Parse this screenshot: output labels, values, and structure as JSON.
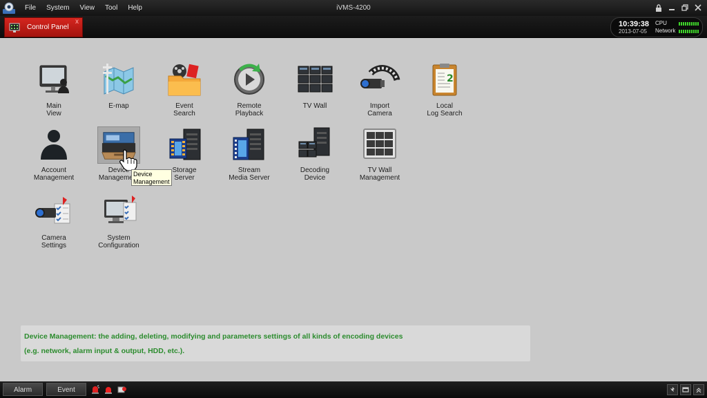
{
  "app": {
    "title": "iVMS-4200",
    "menu": [
      "File",
      "System",
      "View",
      "Tool",
      "Help"
    ]
  },
  "tab": {
    "label": "Control Panel",
    "close": "x"
  },
  "status": {
    "time": "10:39:38",
    "date": "2013-07-05",
    "cpu_label": "CPU",
    "network_label": "Network"
  },
  "modules": [
    {
      "name": "main-view",
      "line1": "Main",
      "line2": "View",
      "icon": "monitor-user-icon"
    },
    {
      "name": "e-map",
      "line1": "E-map",
      "line2": "",
      "icon": "map-icon"
    },
    {
      "name": "event-search",
      "line1": "Event",
      "line2": "Search",
      "icon": "event-folder-icon"
    },
    {
      "name": "remote-playback",
      "line1": "Remote",
      "line2": "Playback",
      "icon": "playback-icon"
    },
    {
      "name": "tv-wall",
      "line1": "TV Wall",
      "line2": "",
      "icon": "tv-wall-icon"
    },
    {
      "name": "import-camera",
      "line1": "Import",
      "line2": "Camera",
      "icon": "camera-film-icon"
    },
    {
      "name": "local-log-search",
      "line1": "Local",
      "line2": "Log Search",
      "icon": "clipboard-icon"
    },
    {
      "name": "account-management",
      "line1": "Account",
      "line2": "Management",
      "icon": "user-silhouette-icon"
    },
    {
      "name": "device-management",
      "line1": "Device",
      "line2": "Management",
      "icon": "device-drawer-icon"
    },
    {
      "name": "storage-server",
      "line1": "Storage",
      "line2": "Server",
      "icon": "storage-server-icon"
    },
    {
      "name": "stream-media-server",
      "line1": "Stream",
      "line2": "Media Server",
      "icon": "stream-server-icon"
    },
    {
      "name": "decoding-device",
      "line1": "Decoding",
      "line2": "Device",
      "icon": "decoder-icon"
    },
    {
      "name": "tv-wall-management",
      "line1": "TV Wall",
      "line2": "Management",
      "icon": "grid-screen-icon"
    },
    {
      "name": "camera-settings",
      "line1": "Camera",
      "line2": "Settings",
      "icon": "camera-settings-icon"
    },
    {
      "name": "system-configuration",
      "line1": "System",
      "line2": "Configuration",
      "icon": "monitor-settings-icon"
    }
  ],
  "tooltip": {
    "line1": "Device",
    "line2": "Management"
  },
  "description": {
    "line1": "Device Management: the adding, deleting, modifying and parameters settings of all kinds of encoding devices",
    "line2": "(e.g. network, alarm input & output, HDD, etc.)."
  },
  "bottom": {
    "alarm": "Alarm",
    "event": "Event"
  },
  "colors": {
    "accent": "#c41d17",
    "desc_text": "#2c8c2e",
    "meter": "#3fd52a"
  }
}
